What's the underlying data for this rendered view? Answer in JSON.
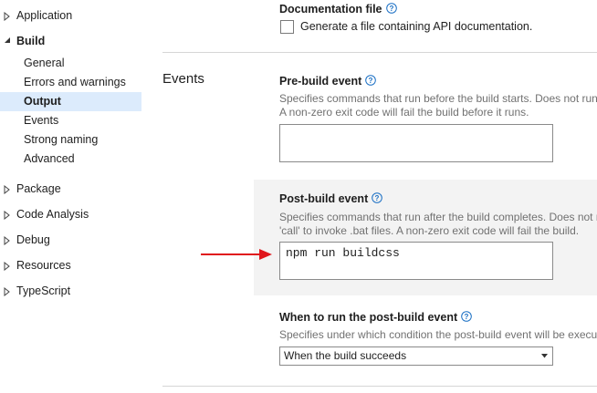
{
  "sidebar": {
    "items": [
      {
        "label": "Application"
      },
      {
        "label": "Build"
      },
      {
        "label": "General"
      },
      {
        "label": "Errors and warnings"
      },
      {
        "label": "Output"
      },
      {
        "label": "Events"
      },
      {
        "label": "Strong naming"
      },
      {
        "label": "Advanced"
      },
      {
        "label": "Package"
      },
      {
        "label": "Code Analysis"
      },
      {
        "label": "Debug"
      },
      {
        "label": "Resources"
      },
      {
        "label": "TypeScript"
      }
    ]
  },
  "documentation": {
    "title": "Documentation file",
    "checkbox_label": "Generate a file containing API documentation.",
    "checked": false
  },
  "events_section": {
    "title": "Events"
  },
  "pre_build": {
    "title": "Pre-build event",
    "desc_line1": "Specifies commands that run before the build starts. Does not run",
    "desc_line2": "A non-zero exit code will fail the build before it runs.",
    "value": ""
  },
  "post_build": {
    "title": "Post-build event",
    "desc_line1": "Specifies commands that run after the build completes. Does not r",
    "desc_line2": "'call' to invoke .bat files. A non-zero exit code will fail the build.",
    "value": "npm run buildcss"
  },
  "run_post_build": {
    "title": "When to run the post-build event",
    "desc_line1": "Specifies under which condition the post-build event will be execu",
    "selected": "When the build succeeds"
  },
  "colors": {
    "selected_bg": "#dcebfc",
    "help_icon": "#1a6fc4",
    "annotation_arrow": "#e0161c"
  }
}
